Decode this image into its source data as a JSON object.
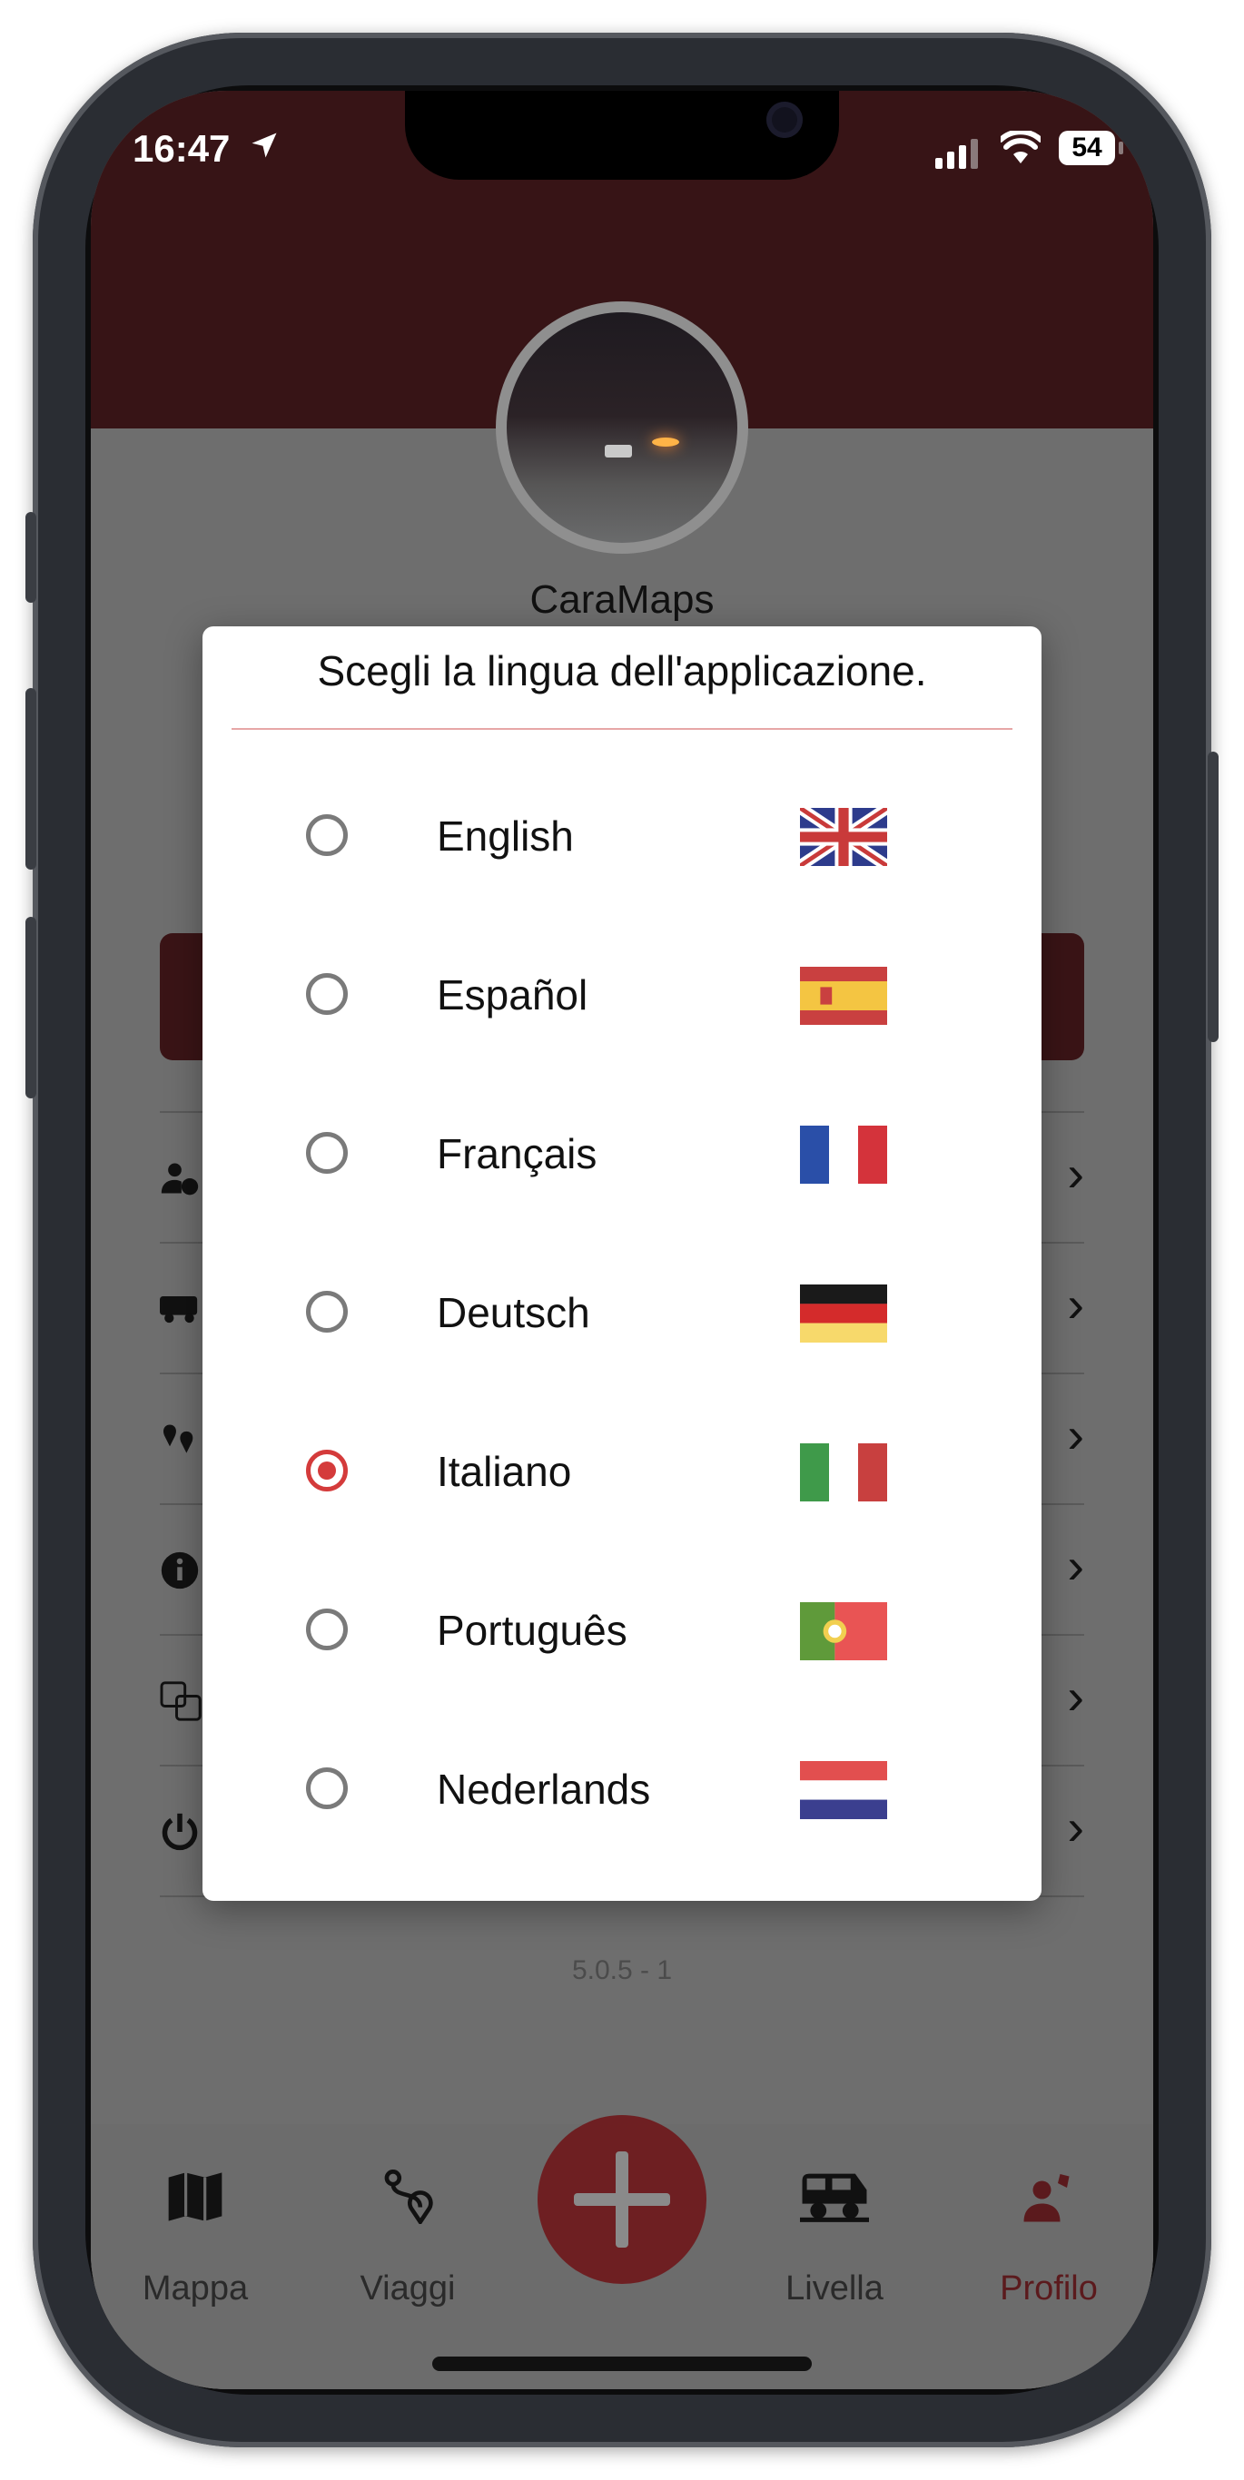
{
  "status": {
    "time": "16:47",
    "battery": "54"
  },
  "profile": {
    "name": "CaraMaps"
  },
  "dialog": {
    "title": "Scegli la lingua dell'applicazione.",
    "options": [
      {
        "label": "English",
        "flag": "uk-flag-icon",
        "selected": false
      },
      {
        "label": "Español",
        "flag": "spain-flag-icon",
        "selected": false
      },
      {
        "label": "Français",
        "flag": "france-flag-icon",
        "selected": false
      },
      {
        "label": "Deutsch",
        "flag": "germany-flag-icon",
        "selected": false
      },
      {
        "label": "Italiano",
        "flag": "italy-flag-icon",
        "selected": true
      },
      {
        "label": "Português",
        "flag": "portugal-flag-icon",
        "selected": false
      },
      {
        "label": "Nederlands",
        "flag": "netherlands-flag-icon",
        "selected": false
      }
    ]
  },
  "menu": {
    "icons": [
      "user-globe-icon",
      "camper-icon",
      "map-pins-icon",
      "info-icon",
      "translate-icon",
      "power-icon"
    ]
  },
  "version": "5.0.5 - 1",
  "tabs": [
    {
      "label": "Mappa",
      "icon": "map-icon"
    },
    {
      "label": "Viaggi",
      "icon": "route-icon"
    },
    {
      "label": "Livella",
      "icon": "camper-level-icon"
    },
    {
      "label": "Profilo",
      "icon": "profile-icon"
    }
  ],
  "colors": {
    "header": "#371416",
    "accent": "#d43b3b",
    "active_tab": "#6e1f22"
  }
}
